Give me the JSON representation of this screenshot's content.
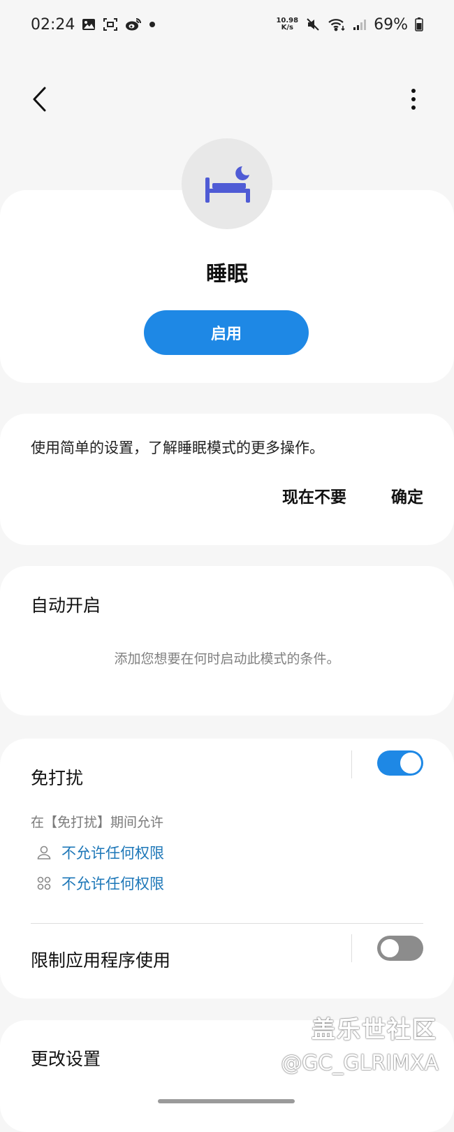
{
  "status_bar": {
    "time": "02:24",
    "net_speed_value": "10.98",
    "net_speed_unit": "K/s",
    "battery": "69%",
    "icons": [
      "gallery-icon",
      "screenshot-icon",
      "weibo-icon",
      "dot-icon",
      "mute-icon",
      "wifi-icon",
      "signal-icon",
      "battery-icon"
    ]
  },
  "mode": {
    "name": "睡眠",
    "enable_label": "启用",
    "icon": "bed-moon-icon",
    "accent_color": "#4f5bd5"
  },
  "tip": {
    "text": "使用简单的设置，了解睡眠模式的更多操作。",
    "dismiss_label": "现在不要",
    "confirm_label": "确定"
  },
  "auto_start": {
    "title": "自动开启",
    "description": "添加您想要在何时启动此模式的条件。"
  },
  "dnd": {
    "title": "免打扰",
    "enabled": true,
    "allow_caption": "在【免打扰】期间允许",
    "permissions": [
      {
        "icon": "person-icon",
        "label": "不允许任何权限"
      },
      {
        "icon": "apps-icon",
        "label": "不允许任何权限"
      }
    ]
  },
  "app_limit": {
    "title": "限制应用程序使用",
    "enabled": false
  },
  "change_settings": {
    "title": "更改设置"
  },
  "watermark": {
    "line1": "盖乐世社区",
    "line2": "@GC_GLRIMXA"
  },
  "colors": {
    "primary": "#1e88e5",
    "link": "#1d77b8",
    "background": "#f6f6f6"
  }
}
